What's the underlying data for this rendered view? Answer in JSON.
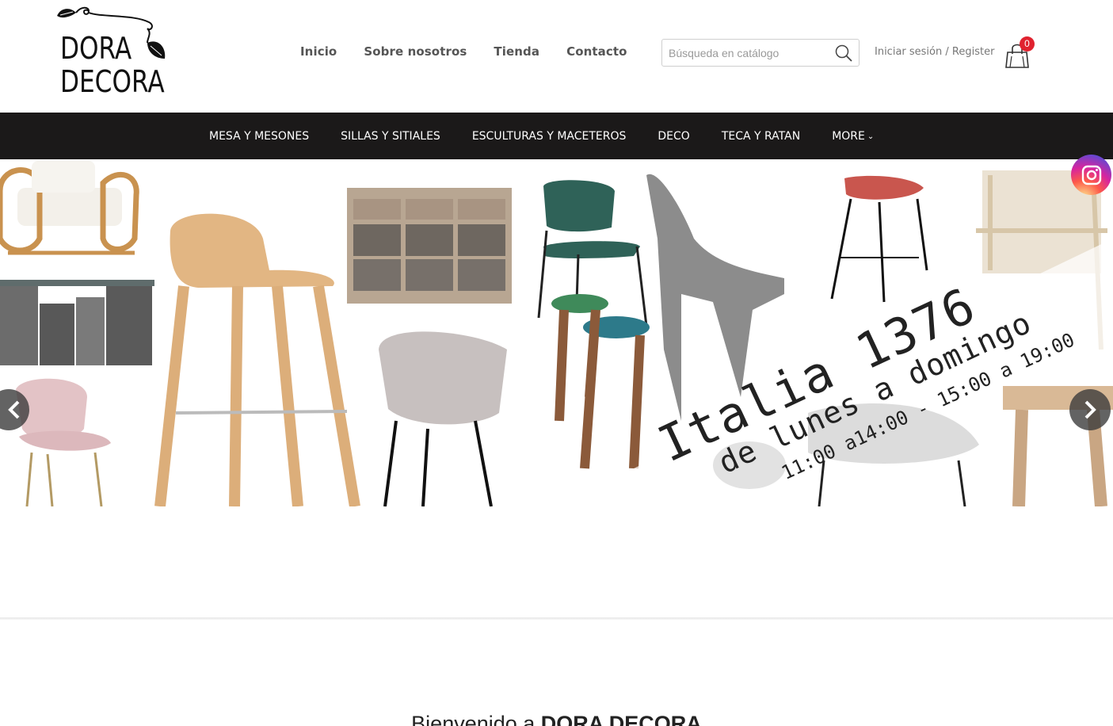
{
  "header": {
    "logo": {
      "line1": "DORA",
      "line2": "DECORA"
    },
    "nav": [
      "Inicio",
      "Sobre nosotros",
      "Tienda",
      "Contacto"
    ],
    "search": {
      "placeholder": "Búsqueda en catálogo"
    },
    "login": {
      "signin": "Iniciar sesión",
      "separator": "/",
      "register": "Register"
    },
    "cart": {
      "count": "0"
    }
  },
  "categories": [
    "MESA Y MESONES",
    "SILLAS Y SITIALES",
    "ESCULTURAS Y MACETEROS",
    "DECO",
    "TECA Y RATAN",
    "MORE"
  ],
  "hero": {
    "line1": "Italia 1376",
    "line2": "de lunes a domingo",
    "line3": "11:00 a14:00 - 15:00 a 19:00"
  },
  "welcome": {
    "prefix": "Bienvenido a ",
    "brand": "DORA DECORA"
  },
  "colors": {
    "category_bar": "#1b1919",
    "cart_badge": "#e0222f",
    "nav_text": "#555555"
  },
  "icons": {
    "search": "search-icon",
    "cart": "shopping-bag-icon",
    "instagram": "instagram-icon",
    "prev": "chevron-left-icon",
    "next": "chevron-right-icon"
  }
}
